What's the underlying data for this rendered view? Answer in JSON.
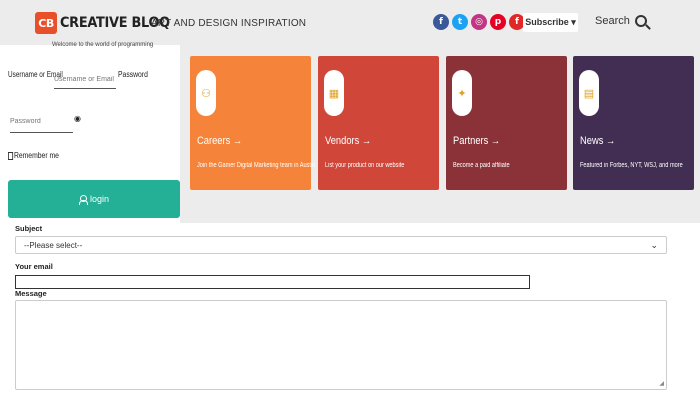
{
  "header": {
    "logo_mark": "CB",
    "logo_text": "CREATIVE BLOQ",
    "tagline": "ART AND DESIGN INSPIRATION",
    "social": [
      {
        "name": "facebook",
        "glyph": "f"
      },
      {
        "name": "twitter",
        "glyph": "t"
      },
      {
        "name": "instagram",
        "glyph": "◎"
      },
      {
        "name": "pinterest",
        "glyph": "p"
      },
      {
        "name": "flipboard",
        "glyph": "f"
      }
    ],
    "subscribe_label": "Subscribe ▾",
    "search_label": "Search"
  },
  "login": {
    "note": "Welcome to the world of programming",
    "username_label": "Username or Email",
    "username_placeholder": "Username or Email",
    "password_label": "Password",
    "password_placeholder": "Password",
    "eye_glyph": "◉",
    "remember_label": "Remember me",
    "button_label": "login"
  },
  "cards": [
    {
      "title": "Careers →",
      "desc": "Join the Gamer Digital Marketing team in Austin",
      "color": "#f5843a",
      "icon": "careers-icon",
      "glyph": "⚇"
    },
    {
      "title": "Vendors →",
      "desc": "List your product on our website",
      "color": "#d0473a",
      "icon": "vendors-icon",
      "glyph": "▦"
    },
    {
      "title": "Partners →",
      "desc": "Become a paid affiliate",
      "color": "#8b3138",
      "icon": "partners-icon",
      "glyph": "✦"
    },
    {
      "title": "News →",
      "desc": "Featured in Forbes, NYT, WSJ, and more",
      "color": "#432e53",
      "icon": "news-icon",
      "glyph": "▤"
    }
  ],
  "form": {
    "subject_label": "Subject",
    "subject_value": "--Please select--",
    "email_label": "Your email",
    "message_label": "Message"
  },
  "colors": {
    "header_bg": "#ececec",
    "login_button": "#23b096",
    "logo_accent": "#e8502a"
  }
}
